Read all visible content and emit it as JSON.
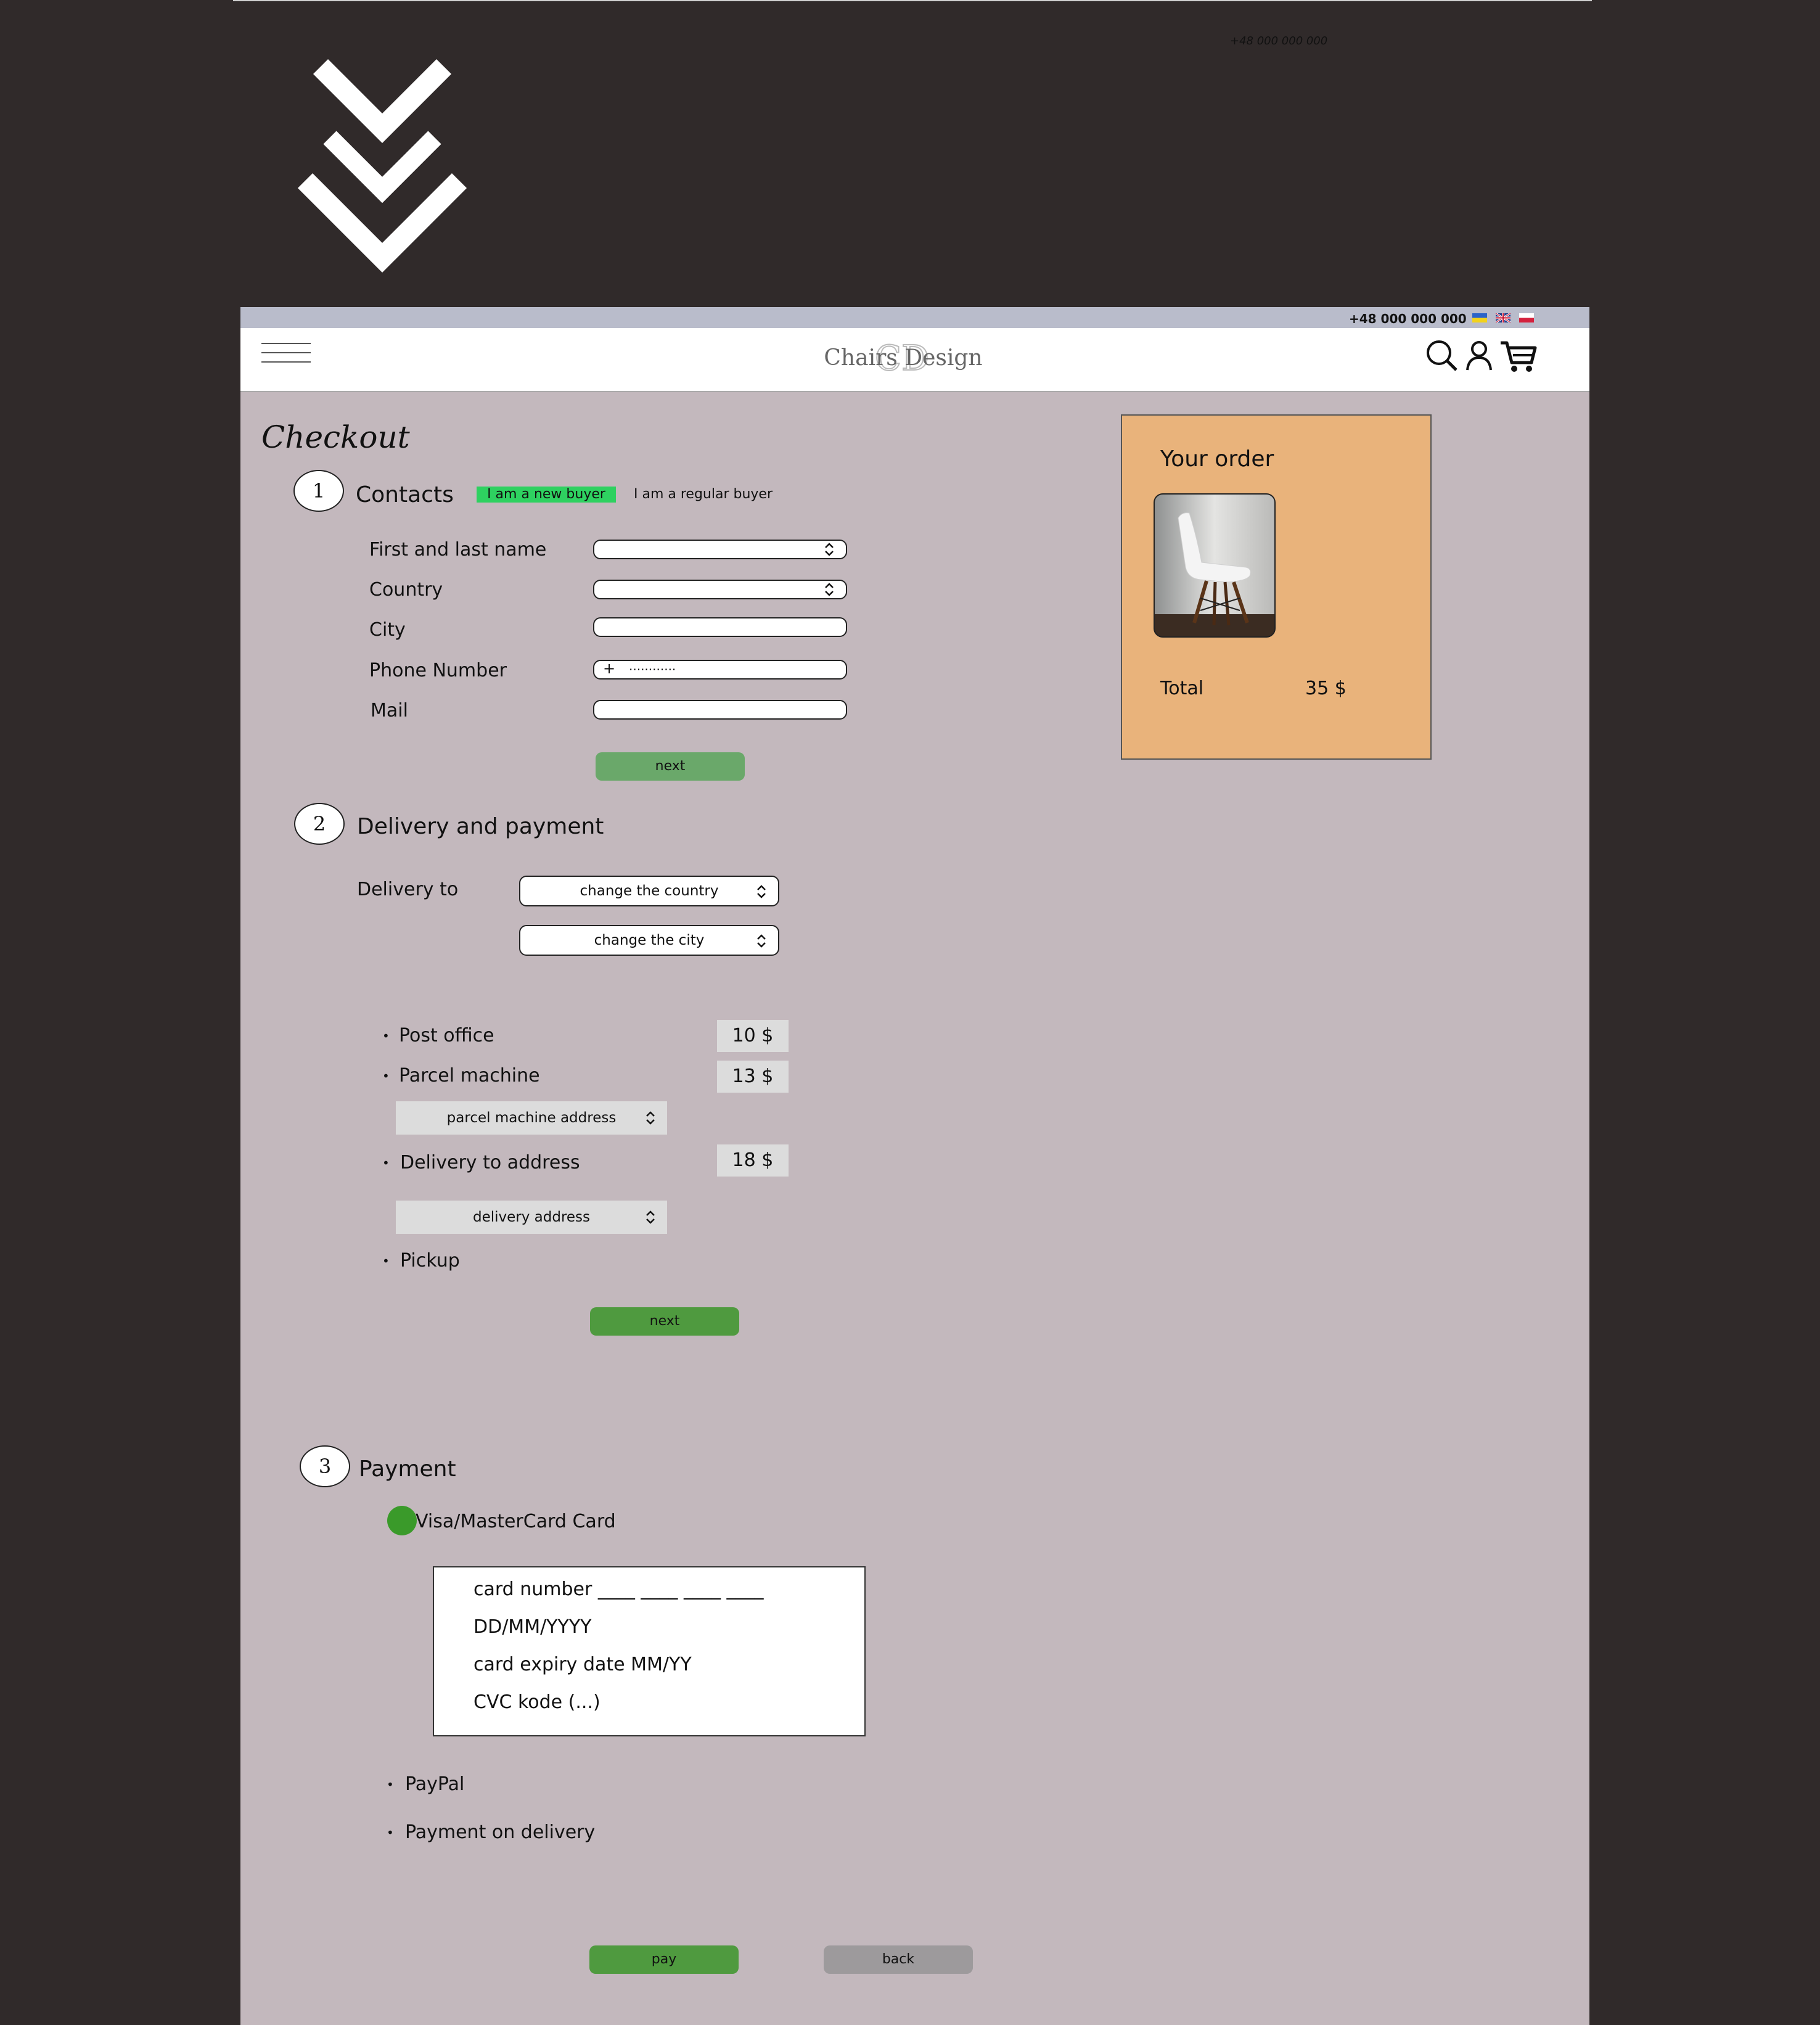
{
  "top_phone": "+48 000 000 000",
  "topbar": {
    "phone": "+48 000 000 000",
    "flags": [
      "ukraine-flag-icon",
      "uk-flag-icon",
      "poland-flag-icon"
    ]
  },
  "header": {
    "logo_text": "Chairs Design",
    "logo_monogram": "CD",
    "icons": [
      "search-icon",
      "user-icon",
      "cart-icon"
    ]
  },
  "page_title": "Checkout",
  "contacts": {
    "step": "1",
    "title": "Contacts",
    "new_buyer_label": "I am a new buyer",
    "regular_buyer_label": "I am a regular buyer",
    "fields": {
      "name_label": "First  and last name",
      "country_label": "Country",
      "city_label": "City",
      "phone_label": "Phone Number",
      "phone_prefix": "+",
      "phone_placeholder": "............",
      "mail_label": "Mail"
    },
    "next_label": "next"
  },
  "delivery": {
    "step": "2",
    "title": "Delivery and payment",
    "delivery_to_label": "Delivery to",
    "country_select": "change the country",
    "city_select": "change the city",
    "options": [
      {
        "label": "Post office",
        "price": "10 $"
      },
      {
        "label": "Parcel machine",
        "price": "13 $"
      },
      {
        "label": "Delivery to address",
        "price": "18 $"
      },
      {
        "label": "Pickup",
        "price": ""
      }
    ],
    "parcel_address_select": "parcel machine address",
    "delivery_address_select": "delivery address",
    "next_label": "next"
  },
  "payment": {
    "step": "3",
    "title": "Payment",
    "card_option": "Visa/MasterCard Card",
    "card_fields": {
      "card_number": "card number ____ ____ ____ ____",
      "date": "DD/MM/YYYY",
      "expiry": "card expiry date  MM/YY",
      "cvc": "CVC kode (...)"
    },
    "paypal_option": "PayPal",
    "on_delivery_option": "Payment on delivery",
    "pay_label": "pay",
    "back_label": "back"
  },
  "order": {
    "title": "Your order",
    "total_label": "Total",
    "total_value": "35 $"
  },
  "colors": {
    "page_bg": "#302a2a",
    "frame_bg": "#c3b8bd",
    "order_bg": "#e9b37b",
    "new_buyer_bg": "#2ed160",
    "selected_radio": "#3a9a2a",
    "button_green": "#6aa86a",
    "button_gray": "#9d9a9c"
  }
}
